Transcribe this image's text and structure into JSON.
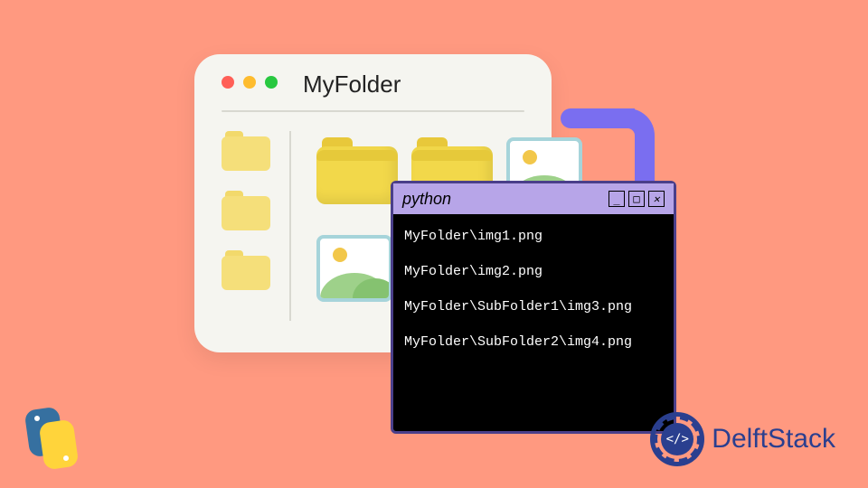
{
  "explorer": {
    "title": "MyFolder"
  },
  "terminal": {
    "title": "python",
    "output": [
      "MyFolder\\img1.png",
      "MyFolder\\img2.png",
      "MyFolder\\SubFolder1\\img3.png",
      "MyFolder\\SubFolder2\\img4.png"
    ]
  },
  "branding": {
    "delftstack": "DelftStack",
    "code_symbol": "</>"
  },
  "colors": {
    "background": "#ff9980",
    "arrow": "#7a6ef0",
    "terminal_titlebar": "#b7a5e8",
    "folder": "#f2d84a",
    "delftstack_blue": "#2a3f8f"
  }
}
